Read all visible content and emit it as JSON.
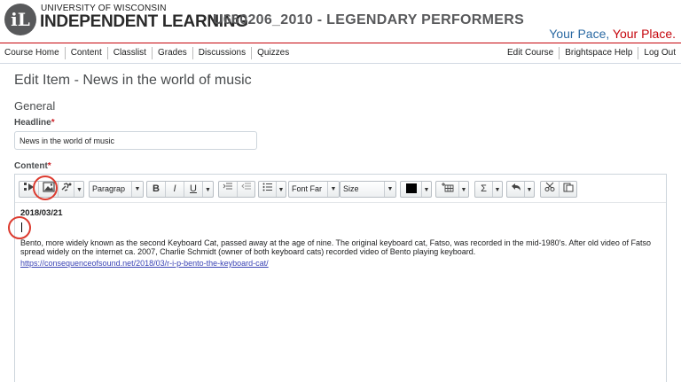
{
  "header": {
    "logo_mark": "iL",
    "university": "UNIVERSITY OF WISCONSIN",
    "program": "INDEPENDENT LEARNING",
    "course_title": "U660206_2010 - LEGENDARY PERFORMERS",
    "tagline_a": "Your Pace,",
    "tagline_b": "Your Place."
  },
  "nav": {
    "left": [
      "Course Home",
      "Content",
      "Classlist",
      "Grades",
      "Discussions",
      "Quizzes"
    ],
    "right": [
      "Edit Course",
      "Brightspace Help",
      "Log Out"
    ]
  },
  "page": {
    "title": "Edit Item - News in the world of music",
    "section": "General",
    "headline_label": "Headline",
    "required_mark": "*",
    "headline_value": "News in the world of music",
    "content_label": "Content"
  },
  "toolbar": {
    "format_value": "Paragrap",
    "font_family_value": "Font Far",
    "size_value": "Size",
    "bold": "B",
    "italic": "I",
    "underline": "U",
    "sigma": "Σ",
    "text_color": "#000000"
  },
  "editor": {
    "date": "2018/03/21",
    "body": "Bento, more widely known as the second Keyboard Cat, passed away at the age of nine. The original keyboard cat, Fatso, was recorded in the mid-1980's. After old video of Fatso spread widely on the internet ca. 2007, Charlie Schmidt (owner of both keyboard cats) recorded video of Bento playing keyboard.",
    "link": "https://consequenceofsound.net/2018/03/r-i-p-bento-the-keyboard-cat/"
  },
  "colors": {
    "brand_red": "#c5050c",
    "tagline_blue": "#2b6aa3",
    "highlight_circle": "#dc3b2f"
  }
}
